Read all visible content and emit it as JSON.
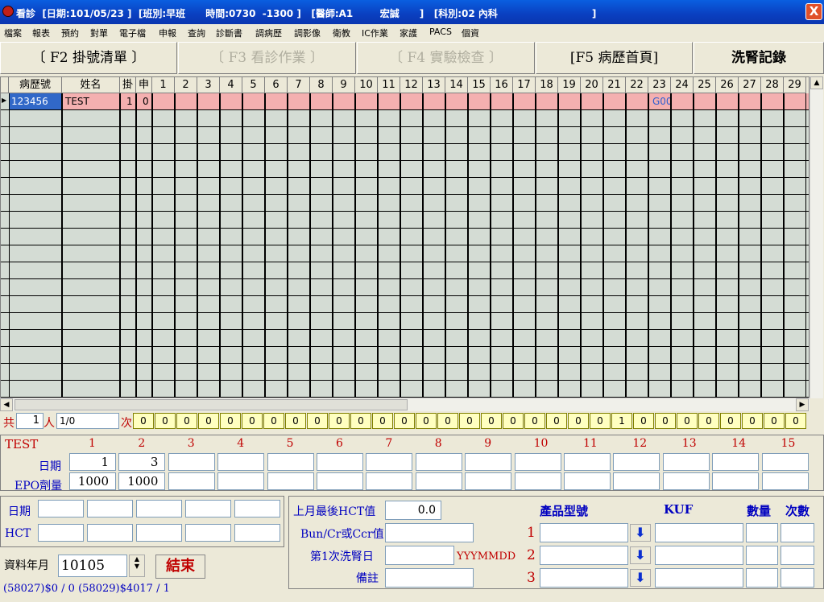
{
  "title": "看診  [日期:101/05/23 ]  [班別:早班      時間:0730  -1300 ]   [醫師:A1        宏誠      ]   [科別:02 內科                            ]",
  "close": "X",
  "menu": [
    "檔案",
    "報表",
    "預約",
    "對單",
    "電子檔",
    "申報",
    "查詢",
    "診斷書",
    "調病歷",
    "調影像",
    "衛教",
    "IC作業",
    "家護",
    "PACS",
    "個資"
  ],
  "tabs": [
    {
      "label": "〔 F2 掛號清單 〕",
      "state": "normal"
    },
    {
      "label": "〔 F3 看診作業 〕",
      "state": "disabled"
    },
    {
      "label": "〔 F4 實驗檢查 〕",
      "state": "disabled"
    },
    {
      "label": "[F5 病歷首頁]",
      "state": "normal"
    },
    {
      "label": "洗腎記錄",
      "state": "selected"
    }
  ],
  "grid": {
    "headers": [
      "病歷號",
      "姓名",
      "掛",
      "申",
      "1",
      "2",
      "3",
      "4",
      "5",
      "6",
      "7",
      "8",
      "9",
      "10",
      "11",
      "12",
      "13",
      "14",
      "15",
      "16",
      "17",
      "18",
      "19",
      "20",
      "21",
      "22",
      "23",
      "24",
      "25",
      "26",
      "27",
      "28",
      "29"
    ],
    "row": {
      "id": "123456",
      "name": "TEST",
      "reg": "1",
      "app": "0",
      "day23": "G00"
    }
  },
  "count": {
    "total_label": "共",
    "count": "1",
    "unit": "人",
    "ratio": "1/0",
    "times_label": "次",
    "values": [
      "0",
      "0",
      "0",
      "0",
      "0",
      "0",
      "0",
      "0",
      "0",
      "0",
      "0",
      "0",
      "0",
      "0",
      "0",
      "0",
      "0",
      "0",
      "0",
      "0",
      "0",
      "0",
      "1",
      "0",
      "0",
      "0",
      "0",
      "0",
      "0",
      "0",
      "0"
    ]
  },
  "epo": {
    "patient": "TEST",
    "cols": [
      "1",
      "2",
      "3",
      "4",
      "5",
      "6",
      "7",
      "8",
      "9",
      "10",
      "11",
      "12",
      "13",
      "14",
      "15"
    ],
    "date_label": "日期",
    "dose_label": "EPO劑量",
    "dates": [
      "1",
      "3"
    ],
    "doses": [
      "1000",
      "1000"
    ]
  },
  "hct": {
    "date_label": "日期",
    "hct_label": "HCT"
  },
  "month": {
    "label": "資料年月",
    "value": "10105",
    "end_button": "結束"
  },
  "footer": "(58027)$0 / 0 (58029)$4017 / 1",
  "right": {
    "last_hct_label": "上月最後HCT值",
    "last_hct_value": "0.0",
    "bun_label": "Bun/Cr或Ccr值",
    "first_dialysis_label": "第1次洗腎日",
    "date_format": "YYYMMDD",
    "note_label": "備註",
    "product_label": "產品型號",
    "kuf_label": "KUF",
    "qty_label": "數量",
    "times_label": "次數",
    "rows": [
      "1",
      "2",
      "3"
    ]
  }
}
